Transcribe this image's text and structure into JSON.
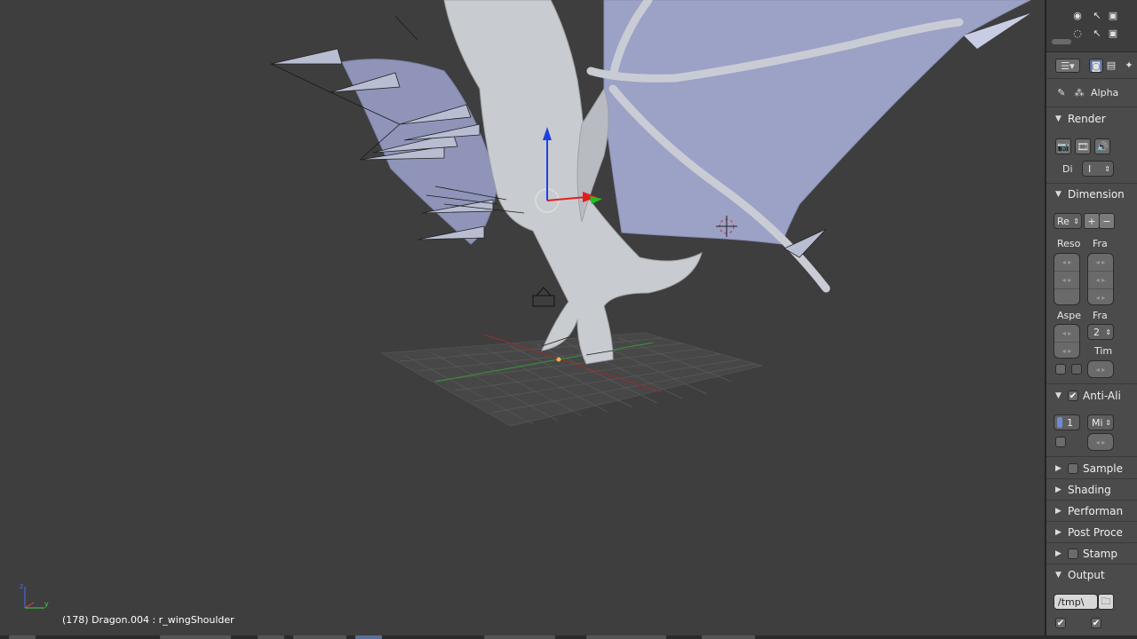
{
  "viewport": {
    "status_text": "(178) Dragon.004 : r_wingShoulder",
    "axis_labels": {
      "z": "z",
      "y": "y"
    }
  },
  "outliner": {
    "icons": [
      "eye-icon",
      "cursor-icon",
      "render-icon"
    ]
  },
  "properties": {
    "context_label": "Alpha",
    "panels": {
      "render": {
        "title": "Render",
        "display_label": "Di",
        "display_value": "I"
      },
      "dimensions": {
        "title": "Dimension",
        "preset_value": "Re",
        "resolution_label": "Reso",
        "frame_range_label": "Fra",
        "aspect_label": "Aspe",
        "frame_rate_label": "Fra",
        "frame_rate_value": "2",
        "time_label": "Tim"
      },
      "anti_aliasing": {
        "title": "Anti-Ali",
        "samples_value": "1",
        "filter_value": "Mi",
        "enabled": true
      },
      "sampled_motion_blur": {
        "title": "Sample"
      },
      "shading": {
        "title": "Shading"
      },
      "performance": {
        "title": "Performan"
      },
      "post_processing": {
        "title": "Post Proce"
      },
      "stamp": {
        "title": "Stamp"
      },
      "output": {
        "title": "Output",
        "path_value": "/tmp\\"
      }
    }
  },
  "colors": {
    "viewport_bg": "#3e3e3e",
    "panel_bg": "#4b4b4b",
    "wing_membrane": "#9ea3c9",
    "axis_x": "#e02020",
    "axis_y": "#20c020",
    "axis_z": "#2040e0"
  }
}
